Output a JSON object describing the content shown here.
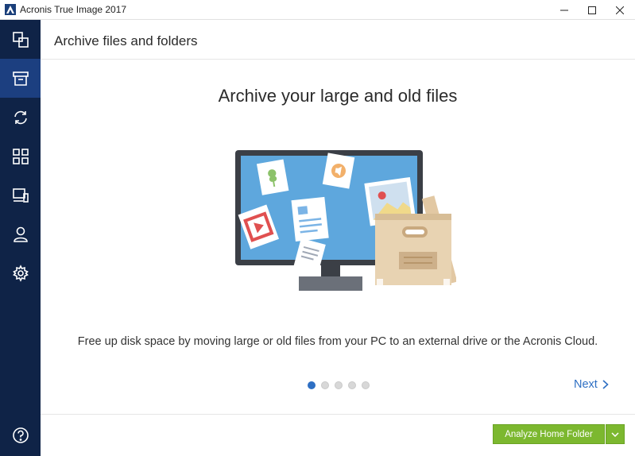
{
  "window": {
    "title": "Acronis True Image 2017",
    "controls": {
      "minimize": "minimize-icon",
      "maximize": "maximize-icon",
      "close": "close-icon"
    }
  },
  "sidebar": {
    "items": [
      {
        "icon": "backup-icon",
        "active": false
      },
      {
        "icon": "archive-icon",
        "active": true
      },
      {
        "icon": "sync-icon",
        "active": false
      },
      {
        "icon": "tools-icon",
        "active": false
      },
      {
        "icon": "dashboard-icon",
        "active": false
      },
      {
        "icon": "account-icon",
        "active": false
      },
      {
        "icon": "settings-icon",
        "active": false
      }
    ],
    "help_icon": "help-icon"
  },
  "header": {
    "title": "Archive files and folders"
  },
  "main": {
    "headline": "Archive your large and old files",
    "description": "Free up disk space by moving large or old files from your PC to an external drive or the Acronis Cloud.",
    "carousel": {
      "total": 5,
      "current": 1
    },
    "next_label": "Next"
  },
  "footer": {
    "analyze_label": "Analyze Home Folder"
  },
  "colors": {
    "sidebar": "#0f2347",
    "sidebar_active": "#1c3f80",
    "accent": "#2e6fc3",
    "button": "#7cb82f"
  }
}
